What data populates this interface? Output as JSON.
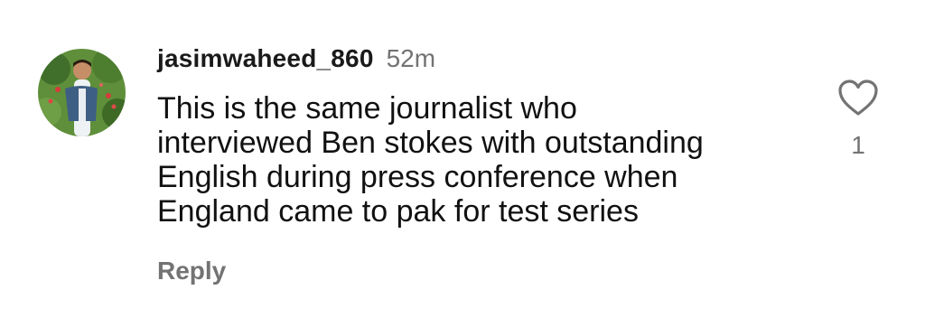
{
  "comment": {
    "username": "jasimwaheed_860",
    "timestamp": "52m",
    "text": "This is the same journalist who\ninterviewed Ben stokes with outstanding\nEnglish during press conference when\nEngland came to pak for test series",
    "reply_label": "Reply",
    "like_count": "1",
    "like_icon": "heart-outline-icon",
    "avatar_icon": "user-avatar"
  },
  "colors": {
    "text_primary": "#111111",
    "text_secondary": "#737373",
    "background": "#ffffff"
  }
}
